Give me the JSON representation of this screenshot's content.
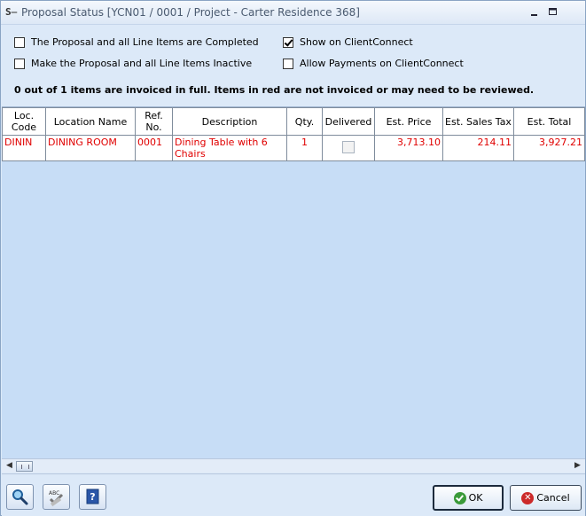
{
  "window": {
    "title": "Proposal Status [YCN01 / 0001 / Project - Carter Residence 368]",
    "minimize_icon": "minimize-icon",
    "maximize_icon": "maximize-icon"
  },
  "options": {
    "completed_label": "The Proposal and all Line Items are Completed",
    "completed_checked": false,
    "inactive_label": "Make the Proposal and all Line Items Inactive",
    "inactive_checked": false,
    "show_clientconnect_label": "Show on ClientConnect",
    "show_clientconnect_checked": true,
    "allow_payments_label": "Allow Payments on ClientConnect",
    "allow_payments_checked": false
  },
  "info_text": "0 out of 1 items are invoiced in full.  Items in red are not invoiced or may need to be reviewed.",
  "table": {
    "columns": [
      "Loc. Code",
      "Location Name",
      "Ref. No.",
      "Description",
      "Qty.",
      "Delivered",
      "Est. Price",
      "Est. Sales Tax",
      "Est. Total"
    ],
    "rows": [
      {
        "loc_code": "DININ",
        "location_name": "DINING ROOM",
        "ref_no": "0001",
        "description": "Dining Table with 6 Chairs",
        "qty": "1",
        "delivered": false,
        "est_price": "3,713.10",
        "est_sales_tax": "214.11",
        "est_total": "3,927.21"
      }
    ],
    "row_text_color": "#e00000"
  },
  "footer": {
    "search_icon": "magnifier-icon",
    "spellcheck_icon": "spellcheck-icon",
    "help_icon": "help-icon",
    "ok_label": "OK",
    "cancel_label": "Cancel"
  }
}
